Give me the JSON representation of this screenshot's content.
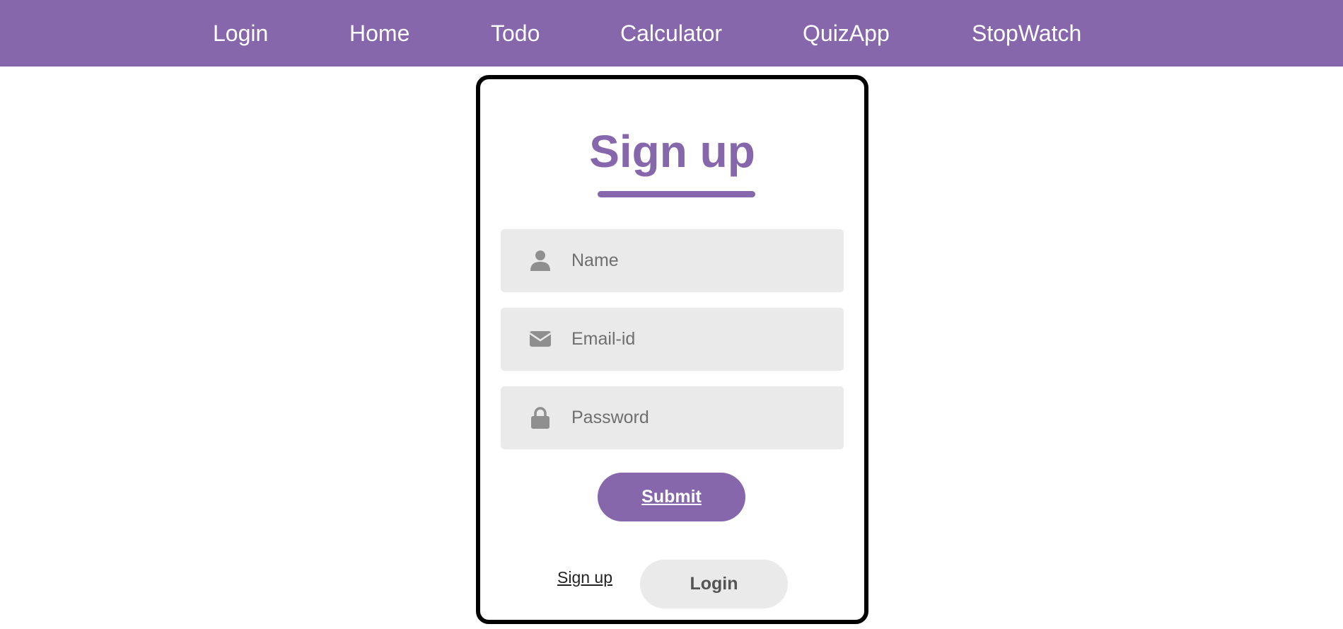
{
  "nav": {
    "items": [
      {
        "label": "Login"
      },
      {
        "label": "Home"
      },
      {
        "label": "Todo"
      },
      {
        "label": "Calculator"
      },
      {
        "label": "QuizApp"
      },
      {
        "label": "StopWatch"
      }
    ]
  },
  "form": {
    "title": "Sign up",
    "fields": {
      "name": {
        "placeholder": "Name",
        "value": "",
        "icon": "user-icon"
      },
      "email": {
        "placeholder": "Email-id",
        "value": "",
        "icon": "envelope-icon"
      },
      "password": {
        "placeholder": "Password",
        "value": "",
        "icon": "lock-icon"
      }
    },
    "submit_label": "Submit",
    "signup_link_label": "Sign up",
    "login_button_label": "Login"
  },
  "colors": {
    "accent": "#8667ac",
    "field_bg": "#eaeaea",
    "card_border": "#000000",
    "icon": "#8f8f8f"
  }
}
